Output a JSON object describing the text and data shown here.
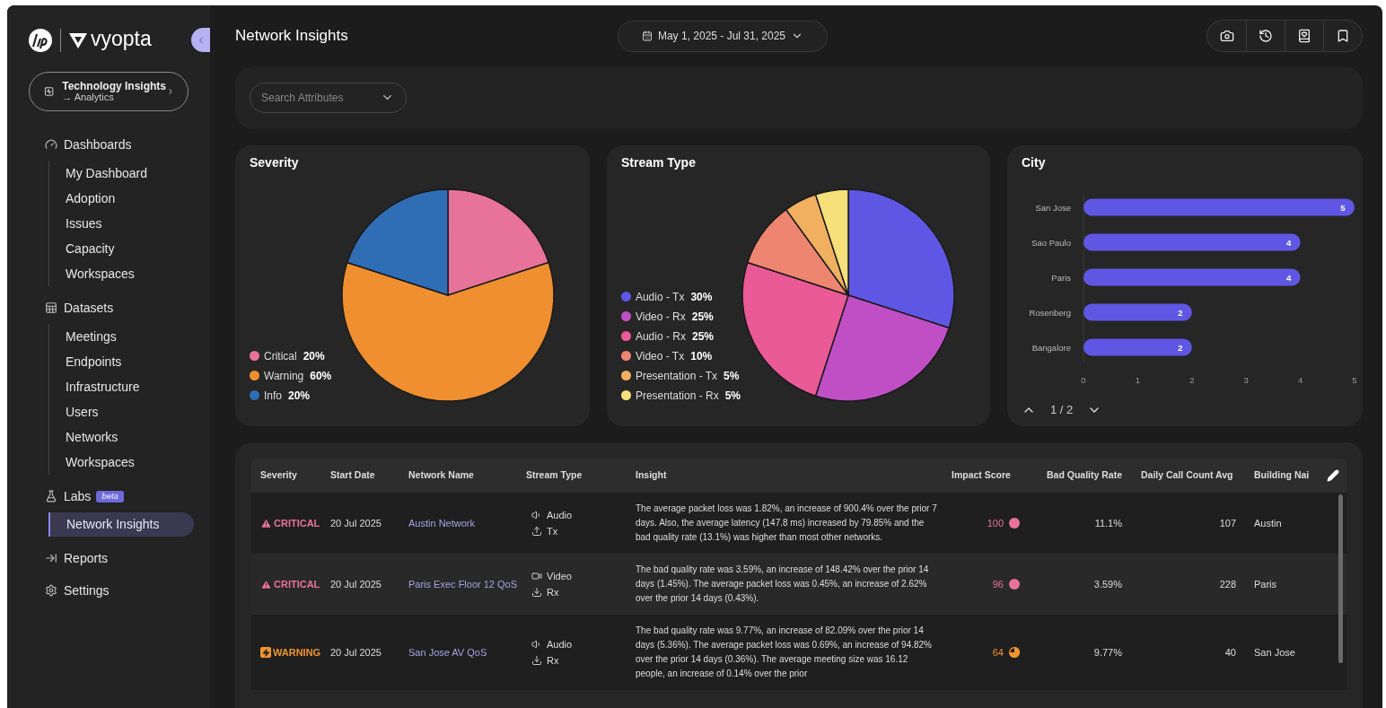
{
  "brand": {
    "logo_text": "vyopta"
  },
  "context": {
    "title": "Technology Insights",
    "subtitle": "→ Analytics"
  },
  "sidebar": {
    "sections": [
      {
        "label": "Dashboards",
        "kind": "dashboards",
        "children": [
          {
            "label": "My Dashboard",
            "selected": false
          },
          {
            "label": "Adoption",
            "selected": false
          },
          {
            "label": "Issues",
            "selected": false
          },
          {
            "label": "Capacity",
            "selected": false
          },
          {
            "label": "Workspaces",
            "selected": false
          }
        ]
      },
      {
        "label": "Datasets",
        "kind": "datasets",
        "children": [
          {
            "label": "Meetings",
            "selected": false
          },
          {
            "label": "Endpoints",
            "selected": false
          },
          {
            "label": "Infrastructure",
            "selected": false
          },
          {
            "label": "Users",
            "selected": false
          },
          {
            "label": "Networks",
            "selected": false
          },
          {
            "label": "Workspaces",
            "selected": false
          }
        ]
      },
      {
        "label": "Labs",
        "kind": "labs",
        "badge": "beta",
        "children": [
          {
            "label": "Network Insights",
            "selected": true
          }
        ]
      },
      {
        "label": "Reports",
        "kind": "reports"
      },
      {
        "label": "Settings",
        "kind": "settings"
      }
    ]
  },
  "header": {
    "title": "Network Insights",
    "date_range": "May 1, 2025 - Jul 31, 2025",
    "actions": [
      {
        "kind": "camera"
      },
      {
        "kind": "history"
      },
      {
        "kind": "book"
      },
      {
        "kind": "bookmark"
      }
    ]
  },
  "filters": {
    "search": {
      "placeholder": "Search Attributes"
    }
  },
  "cards": [
    {
      "legend": [
        {
          "value": "20%",
          "color": "#e8739a"
        },
        {
          "value": "60%",
          "color": "#ef8f2f"
        },
        {
          "value": "20%",
          "color": "#2f6db5"
        }
      ],
      "chart_data": {
        "type": "pie",
        "title": "Severity",
        "categories": [
          "Critical",
          "Warning",
          "Info"
        ],
        "values": [
          20,
          60,
          20
        ]
      }
    },
    {
      "legend": [
        {
          "value": "30%",
          "color": "#5f57e3"
        },
        {
          "value": "25%",
          "color": "#c04fc6"
        },
        {
          "value": "25%",
          "color": "#ea5a97"
        },
        {
          "value": "10%",
          "color": "#ee8570"
        },
        {
          "value": "5%",
          "color": "#f0b060"
        },
        {
          "value": "5%",
          "color": "#f6e07a"
        }
      ],
      "chart_data": {
        "type": "pie",
        "title": "Stream Type",
        "categories": [
          "Audio - Tx",
          "Video - Rx",
          "Audio - Rx",
          "Video - Tx",
          "Presentation - Tx",
          "Presentation - Rx"
        ],
        "values": [
          30,
          25,
          25,
          10,
          5,
          5
        ]
      }
    },
    {
      "pager": "1 / 2",
      "chart_data": {
        "type": "bar",
        "orientation": "horizontal",
        "title": "City",
        "categories": [
          "San Jose",
          "Sao Paulo",
          "Paris",
          "Rosenberg",
          "Bangalore"
        ],
        "values": [
          5,
          4,
          4,
          2,
          2
        ],
        "xlim": [
          0,
          5
        ],
        "xticks": [
          0,
          1,
          2,
          3,
          4,
          5
        ],
        "data_labels": true
      }
    }
  ],
  "table": {
    "columns": [
      "Severity",
      "Start Date",
      "Network Name",
      "Stream Type",
      "Insight",
      "Impact Score",
      "Bad Quality Rate",
      "Daily Call Count Avg",
      "Building Nai"
    ],
    "rows": [
      {
        "severity": {
          "kind": "critical",
          "label": "CRITICAL"
        },
        "start_date": "20 Jul 2025",
        "network_name": "Austin Network",
        "stream": {
          "media": {
            "kind": "audio",
            "label": "Audio"
          },
          "direction": {
            "kind": "tx",
            "label": "Tx"
          }
        },
        "insight": "The average packet loss was 1.82%, an increase of 900.4% over the prior 7 days. Also, the average latency (147.8 ms) increased by 79.85% and the bad quality rate (13.1%) was higher than most other networks.",
        "impact": {
          "score": "100",
          "kind": "full"
        },
        "bad_quality_rate": "11.1%",
        "daily_call_count_avg": "107",
        "building_name": "Austin"
      },
      {
        "severity": {
          "kind": "critical",
          "label": "CRITICAL"
        },
        "start_date": "20 Jul 2025",
        "network_name": "Paris Exec Floor 12 QoS",
        "stream": {
          "media": {
            "kind": "video",
            "label": "Video"
          },
          "direction": {
            "kind": "rx",
            "label": "Rx"
          }
        },
        "insight": "The bad quality rate was 3.59%, an increase of 148.42% over the prior 14 days (1.45%). The average packet loss was 0.45%, an increase of 2.62% over the prior 14 days (0.43%).",
        "impact": {
          "score": "96",
          "kind": "full"
        },
        "bad_quality_rate": "3.59%",
        "daily_call_count_avg": "228",
        "building_name": "Paris"
      },
      {
        "severity": {
          "kind": "warning",
          "label": "WARNING"
        },
        "start_date": "20 Jul 2025",
        "network_name": "San Jose AV QoS",
        "stream": {
          "media": {
            "kind": "audio",
            "label": "Audio"
          },
          "direction": {
            "kind": "rx",
            "label": "Rx"
          }
        },
        "insight": "The bad quality rate was 9.77%, an increase of 82.09% over the prior 14 days (5.36%). The average packet loss was 0.69%, an increase of 94.82% over the prior 14 days (0.36%). The average meeting size was 16.12 people, an increase of 0.14% over the prior",
        "impact": {
          "score": "64",
          "kind": "partial"
        },
        "bad_quality_rate": "9.77%",
        "daily_call_count_avg": "40",
        "building_name": "San Jose"
      }
    ]
  }
}
